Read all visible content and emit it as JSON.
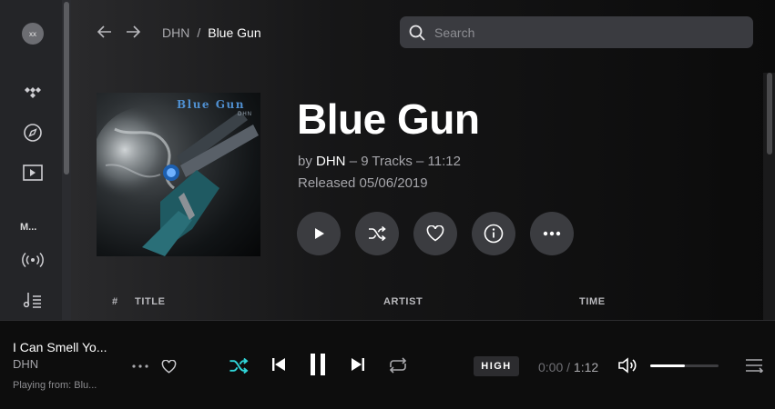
{
  "sidebar": {
    "avatar_text": "xx",
    "section_label": "M...",
    "icons": [
      "tidal-logo-icon",
      "compass-icon",
      "video-icon",
      "radio-icon",
      "playlist-icon"
    ]
  },
  "nav": {
    "breadcrumb_parent": "DHN",
    "breadcrumb_sep": "/",
    "breadcrumb_current": "Blue Gun"
  },
  "search": {
    "placeholder": "Search"
  },
  "album": {
    "cover_title": "Blue Gun",
    "cover_artist": "DHN",
    "title": "Blue Gun",
    "by_prefix": "by",
    "artist": "DHN",
    "details": "– 9 Tracks – 11:12",
    "released": "Released 05/06/2019"
  },
  "actions": [
    "play-icon",
    "shuffle-icon",
    "heart-icon",
    "info-icon",
    "more-icon"
  ],
  "table": {
    "headers": {
      "num": "#",
      "title": "TITLE",
      "artist": "ARTIST",
      "time": "TIME"
    }
  },
  "player": {
    "track_title": "I Can Smell Yo...",
    "track_artist": "DHN",
    "playing_from": "Playing from:  Blu...",
    "quality": "HIGH",
    "elapsed": "0:00",
    "separator": " / ",
    "duration": "1:12",
    "volume_fraction": 0.5,
    "accent": "#30d5d8"
  }
}
